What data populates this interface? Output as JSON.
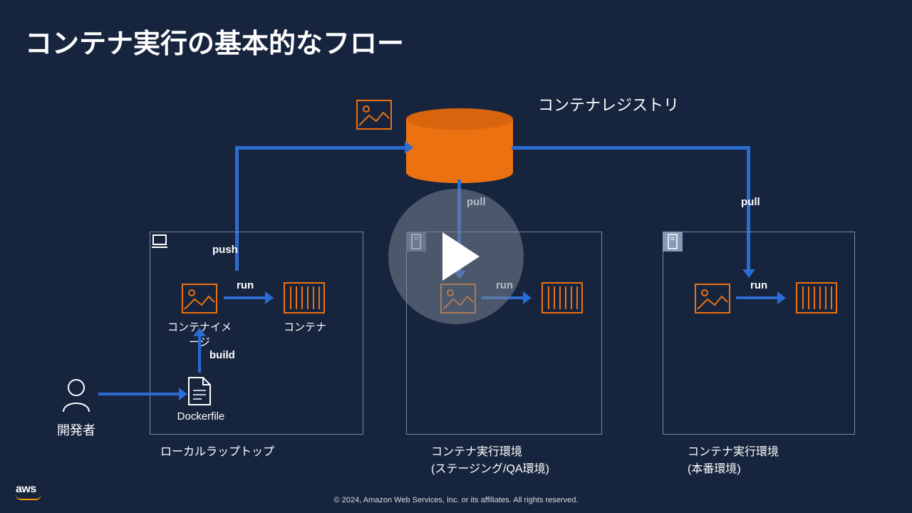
{
  "title": "コンテナ実行の基本的なフロー",
  "registry_label": "コンテナレジストリ",
  "actions": {
    "push": "push",
    "pull": "pull",
    "run": "run",
    "build": "build"
  },
  "items": {
    "container_image": "コンテナイメージ",
    "container": "コンテナ",
    "dockerfile": "Dockerfile",
    "developer": "開発者"
  },
  "environments": {
    "local": "ローカルラップトップ",
    "staging": "コンテナ実行環境\n(ステージング/QA環境)",
    "production": "コンテナ実行環境\n(本番環境)"
  },
  "footer": {
    "aws": "aws",
    "copyright": "© 2024, Amazon Web Services, Inc. or its affiliates. All rights reserved."
  },
  "colors": {
    "accent_orange": "#ec7211",
    "accent_blue": "#2a6cd1",
    "bg": "#16243d"
  }
}
